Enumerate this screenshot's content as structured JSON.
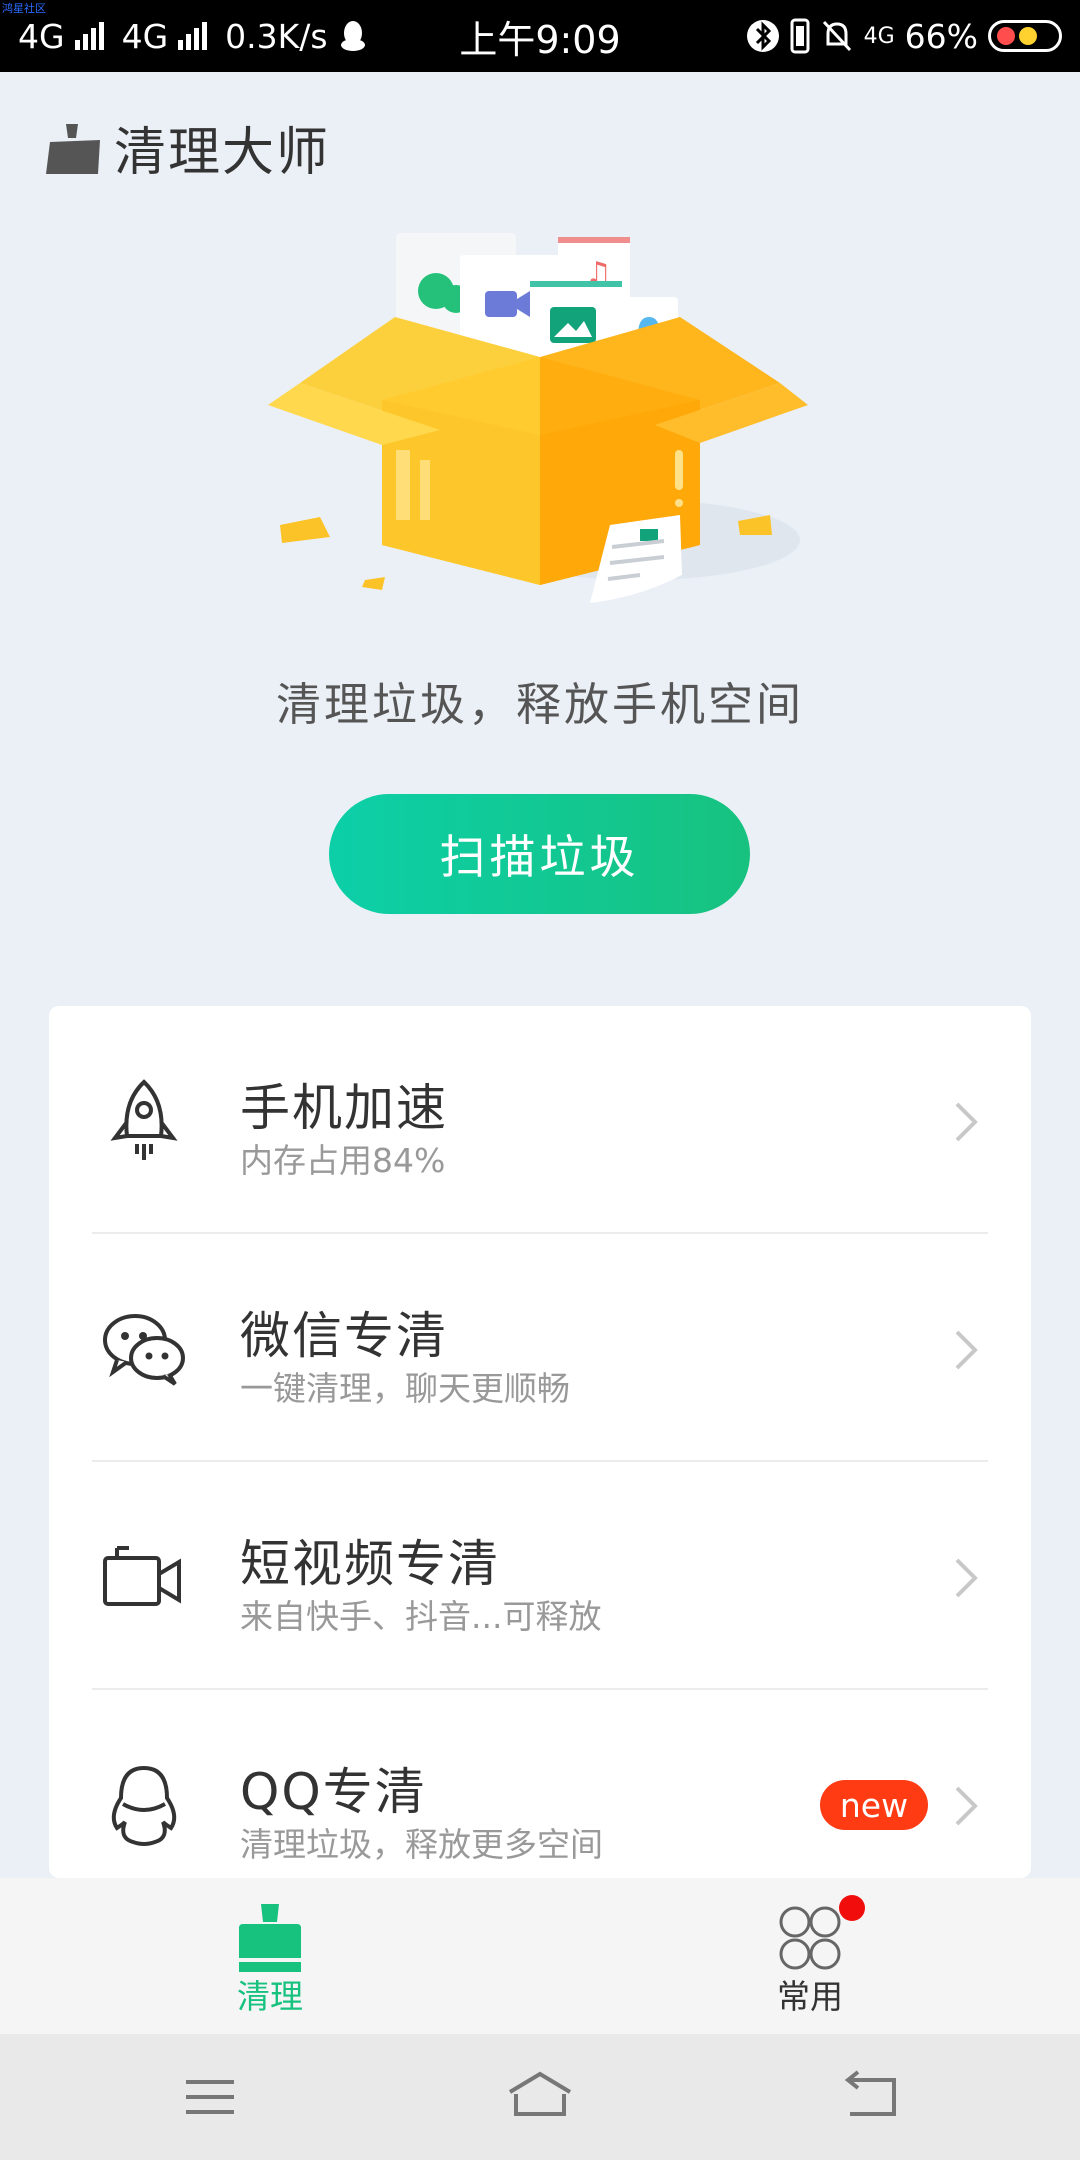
{
  "status_bar": {
    "network1": "4G",
    "network2": "4G",
    "speed": "0.3K/s",
    "time": "上午9:09",
    "network3": "4G",
    "battery": "66%",
    "corner_tag": "鸿星社区"
  },
  "header": {
    "icon": "broom-icon",
    "title": "清理大师"
  },
  "hero": {
    "tagline": "清理垃圾，释放手机空间",
    "scan_button": "扫描垃圾"
  },
  "features": [
    {
      "icon": "rocket-icon",
      "title": "手机加速",
      "subtitle": "内存占用84%",
      "badge": ""
    },
    {
      "icon": "wechat-icon",
      "title": "微信专清",
      "subtitle": "一键清理，聊天更顺畅",
      "badge": ""
    },
    {
      "icon": "video-camera-icon",
      "title": "短视频专清",
      "subtitle": "来自快手、抖音...可释放",
      "badge": ""
    },
    {
      "icon": "qq-icon",
      "title": "QQ专清",
      "subtitle": "清理垃圾，释放更多空间",
      "badge": "new"
    }
  ],
  "tabs": [
    {
      "label": "清理",
      "active": true
    },
    {
      "label": "常用",
      "active": false
    }
  ],
  "colors": {
    "accent": "#17c27f",
    "background": "#eaf0f6",
    "badge": "#ff3b14"
  }
}
